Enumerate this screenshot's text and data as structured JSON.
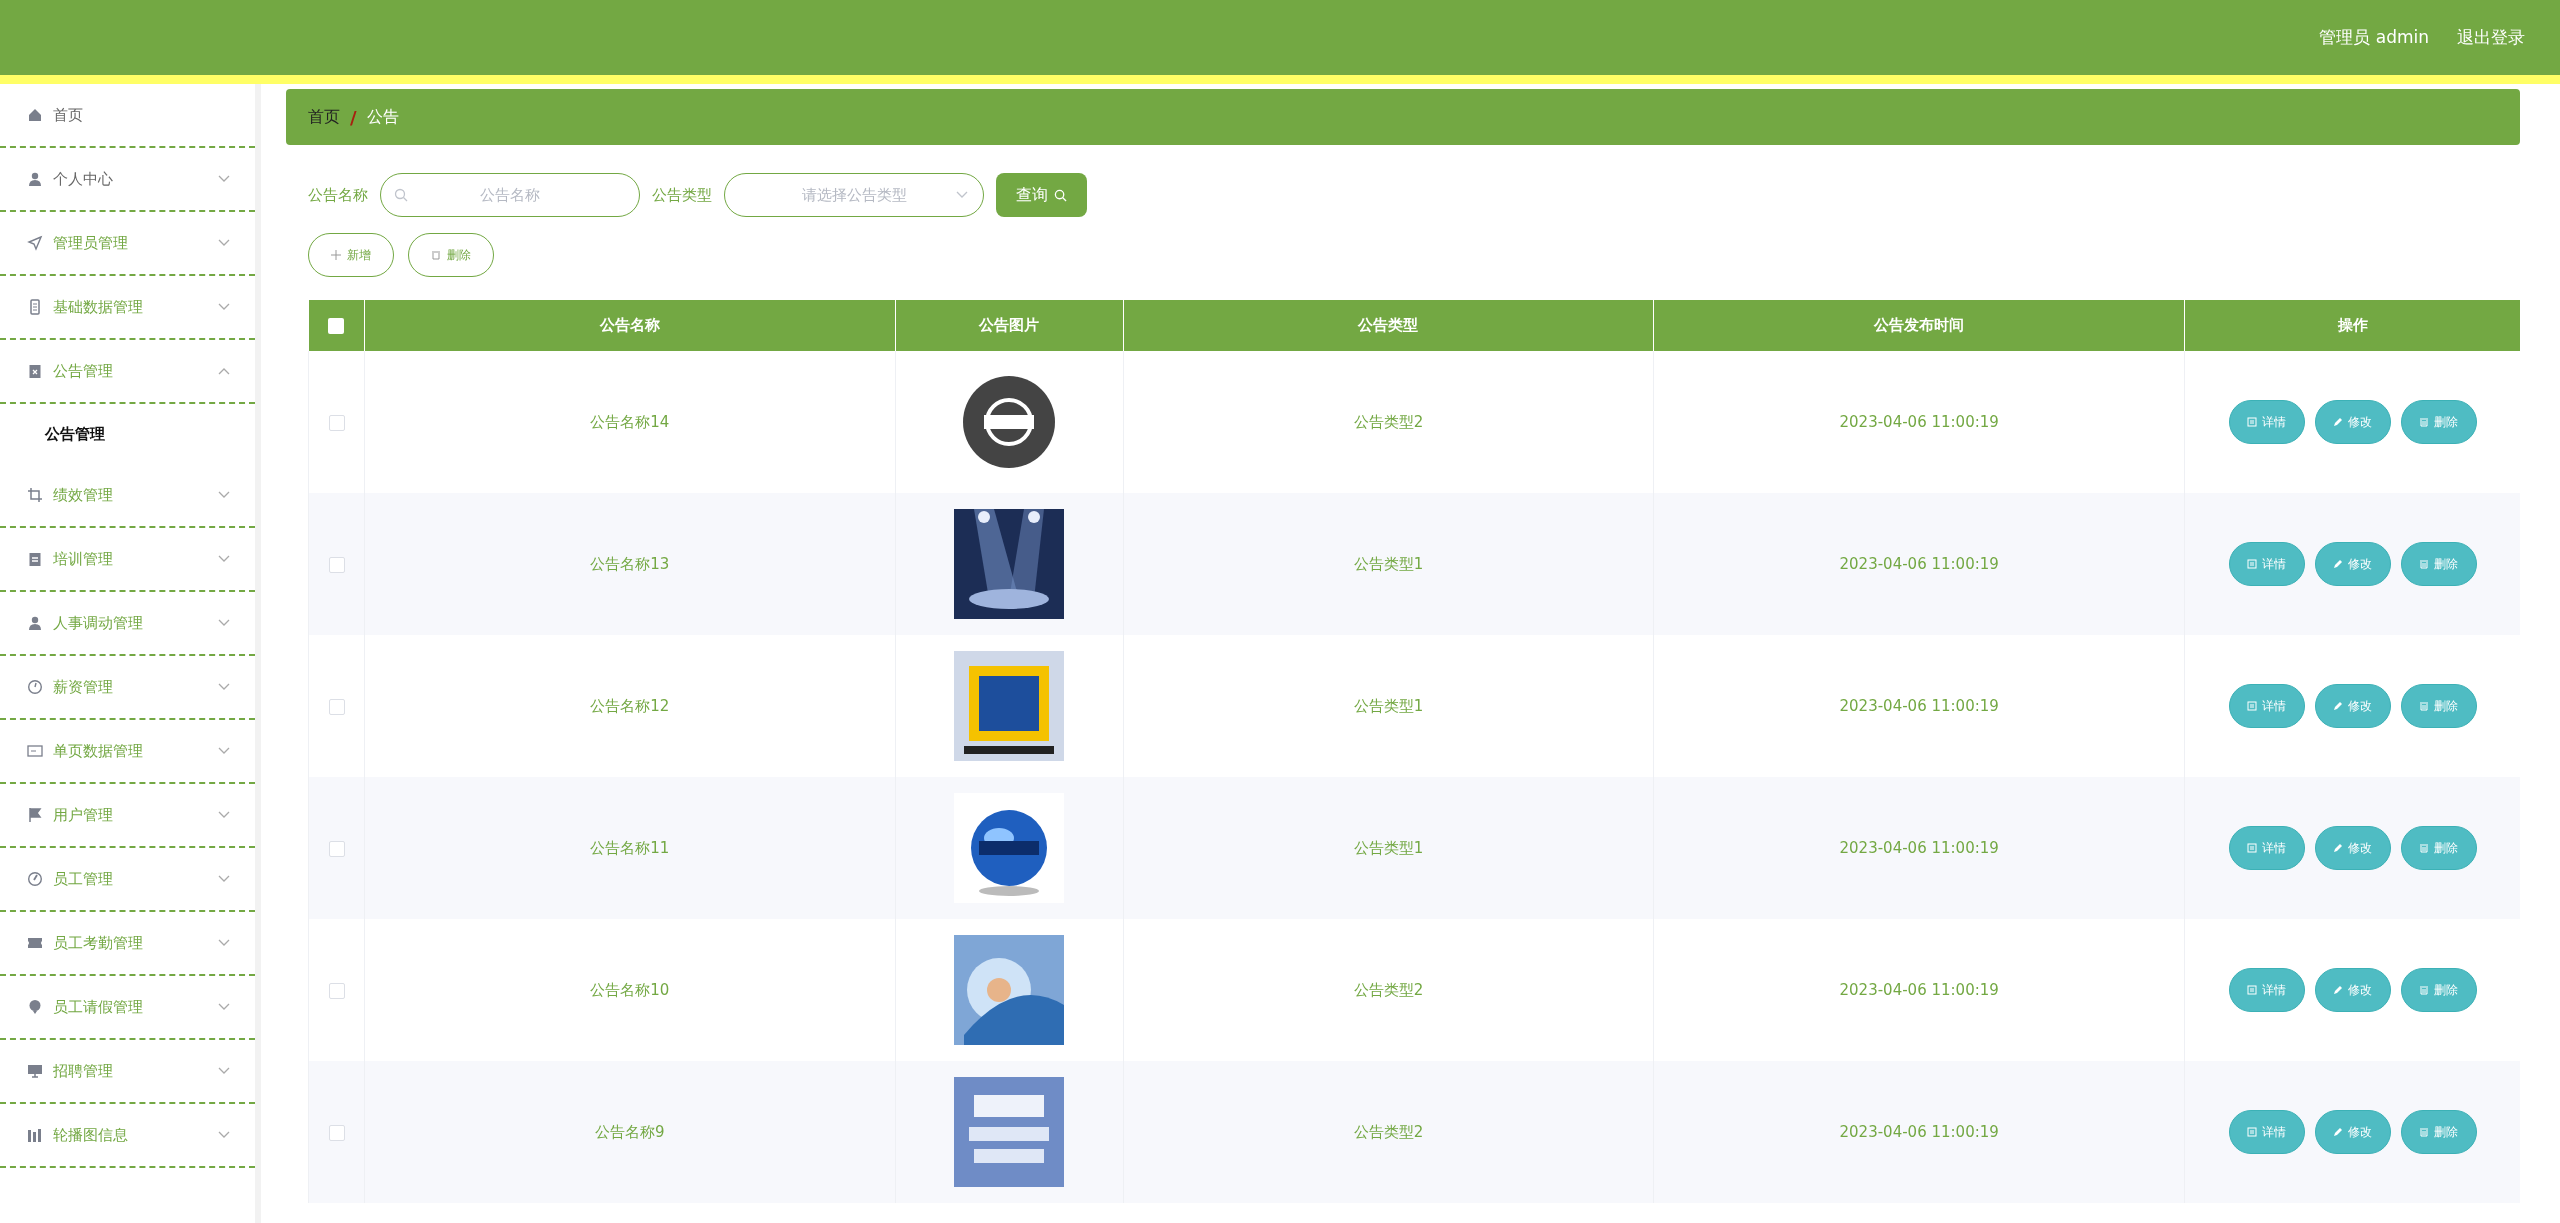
{
  "header": {
    "user": "管理员 admin",
    "logout": "退出登录"
  },
  "sidebar": {
    "items": [
      {
        "label": "首页"
      },
      {
        "label": "个人中心",
        "expanded": false
      },
      {
        "label": "管理员管理",
        "expanded": false
      },
      {
        "label": "基础数据管理",
        "expanded": false
      },
      {
        "label": "公告管理",
        "expanded": true,
        "children": [
          {
            "label": "公告管理",
            "selected": true
          }
        ]
      },
      {
        "label": "绩效管理",
        "expanded": false
      },
      {
        "label": "培训管理",
        "expanded": false
      },
      {
        "label": "人事调动管理",
        "expanded": false
      },
      {
        "label": "薪资管理",
        "expanded": false
      },
      {
        "label": "单页数据管理",
        "expanded": false
      },
      {
        "label": "用户管理",
        "expanded": false
      },
      {
        "label": "员工管理",
        "expanded": false
      },
      {
        "label": "员工考勤管理",
        "expanded": false
      },
      {
        "label": "员工请假管理",
        "expanded": false
      },
      {
        "label": "招聘管理",
        "expanded": false
      },
      {
        "label": "轮播图信息",
        "expanded": false
      }
    ]
  },
  "breadcrumb": {
    "separator": "/",
    "items": [
      "首页",
      "公告"
    ]
  },
  "search": {
    "name_label": "公告名称",
    "name_placeholder": "公告名称",
    "type_label": "公告类型",
    "type_placeholder": "请选择公告类型",
    "query_button": "查询"
  },
  "actions": {
    "add": "新增",
    "delete": "删除"
  },
  "table": {
    "select_all_checked": false,
    "columns": [
      "公告名称",
      "公告图片",
      "公告类型",
      "公告发布时间",
      "操作"
    ],
    "rows": [
      {
        "checked": false,
        "name": "公告名称14",
        "type": "公告类型2",
        "time": "2023-04-06 11:00:19",
        "buttons": [
          "详情",
          "修改",
          "删除"
        ]
      },
      {
        "checked": false,
        "name": "公告名称13",
        "type": "公告类型1",
        "time": "2023-04-06 11:00:19",
        "buttons": [
          "详情",
          "修改",
          "删除"
        ]
      },
      {
        "checked": false,
        "name": "公告名称12",
        "type": "公告类型1",
        "time": "2023-04-06 11:00:19",
        "buttons": [
          "详情",
          "修改",
          "删除"
        ]
      },
      {
        "checked": false,
        "name": "公告名称11",
        "type": "公告类型1",
        "time": "2023-04-06 11:00:19",
        "buttons": [
          "详情",
          "修改",
          "删除"
        ]
      },
      {
        "checked": false,
        "name": "公告名称10",
        "type": "公告类型2",
        "time": "2023-04-06 11:00:19",
        "buttons": [
          "详情",
          "修改",
          "删除"
        ]
      },
      {
        "checked": false,
        "name": "公告名称9",
        "type": "公告类型2",
        "time": "2023-04-06 11:00:19",
        "buttons": [
          "详情",
          "修改",
          "删除"
        ]
      }
    ]
  }
}
